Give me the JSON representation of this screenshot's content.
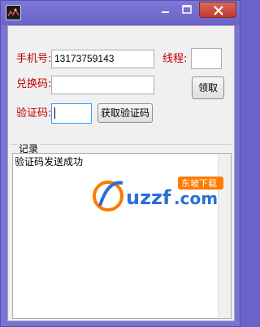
{
  "form": {
    "phone_label": "手机号:",
    "phone_value": "13173759143",
    "thread_label": "线程:",
    "thread_value": "",
    "redeem_label": "兑换码:",
    "redeem_value": "",
    "claim_button": "领取",
    "verify_label": "验证码:",
    "verify_value": "",
    "get_code_button": "获取验证码"
  },
  "log": {
    "group_label": "记录",
    "text": "验证码发送成功"
  },
  "watermark": {
    "brand": "uzzf",
    "suffix": ".com",
    "badge": "东坡下载"
  },
  "colors": {
    "titlebar": "#7b73d4",
    "label": "#c00000",
    "close": "#c0392b",
    "watermark_orange": "#ff7a00",
    "watermark_blue": "#2a6fd6"
  }
}
